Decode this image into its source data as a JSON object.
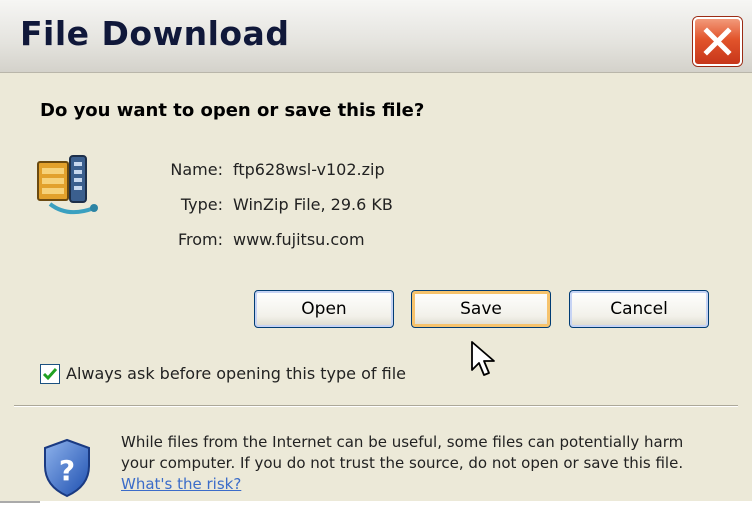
{
  "window": {
    "title": "File Download",
    "close_icon": "close-icon"
  },
  "prompt": {
    "question": "Do you want to open or save this file?"
  },
  "file": {
    "icon": "winzip-file-icon",
    "name_label": "Name:",
    "name_value": "ftp628wsl-v102.zip",
    "type_label": "Type:",
    "type_value": "WinZip File, 29.6 KB",
    "from_label": "From:",
    "from_value": "www.fujitsu.com"
  },
  "buttons": {
    "open": "Open",
    "save": "Save",
    "cancel": "Cancel"
  },
  "always_ask": {
    "label": "Always ask before opening this type of file",
    "checked": true
  },
  "warning": {
    "icon": "shield-question-icon",
    "text": "While files from the Internet can be useful, some files can potentially harm your computer. If you do not trust the source, do not open or save this file.",
    "link": "What's the risk?"
  },
  "colors": {
    "dialog_bg": "#ece9d8",
    "close_red": "#e2542b",
    "link_blue": "#3b6cc9",
    "save_focus": "#f6c36d"
  }
}
